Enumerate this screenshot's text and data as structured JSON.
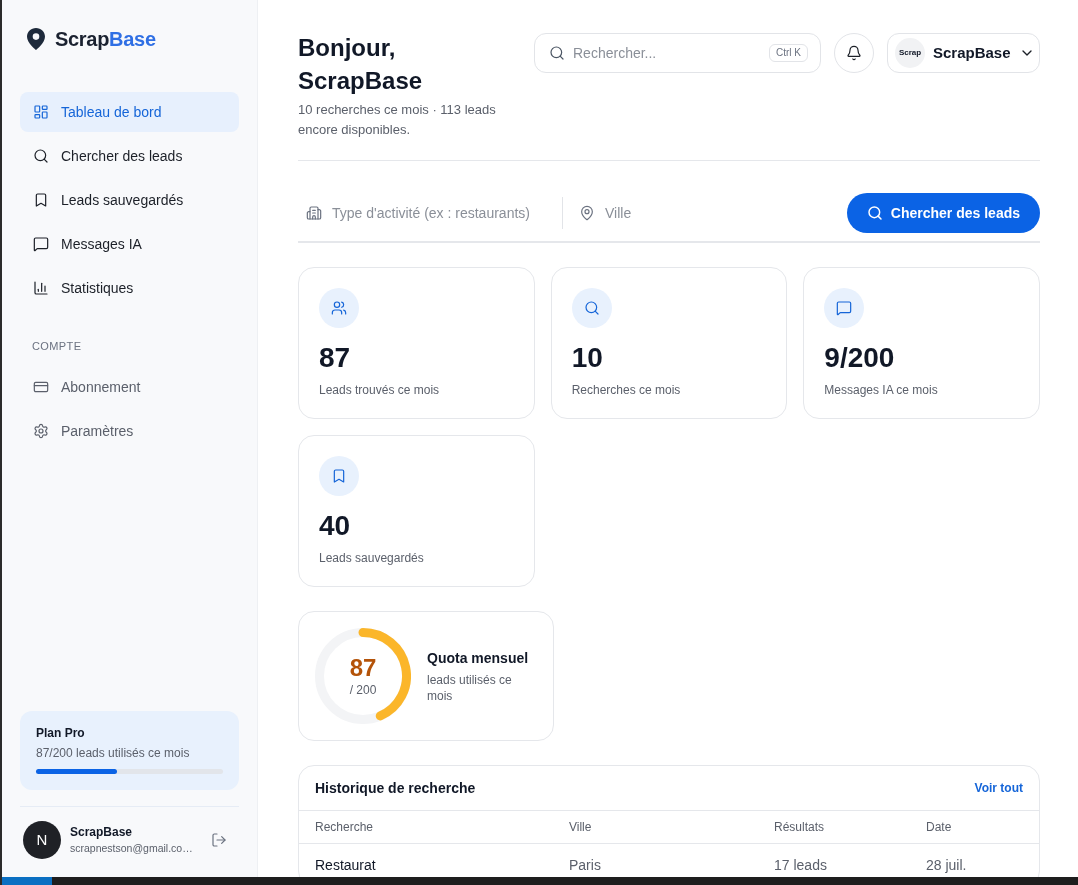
{
  "sidebar": {
    "brand": {
      "name_main": "Scrap",
      "name_accent": "Base"
    },
    "nav": [
      {
        "label": "Tableau de bord",
        "selected": true
      },
      {
        "label": "Chercher des leads",
        "selected": false
      },
      {
        "label": "Leads sauvegardés",
        "selected": false
      },
      {
        "label": "Messages IA",
        "selected": false
      },
      {
        "label": "Statistiques",
        "selected": false
      }
    ],
    "account_section": {
      "heading": "COMPTE",
      "items": [
        {
          "label": "Abonnement",
          "selected": false
        },
        {
          "label": "Paramètres",
          "selected": false
        }
      ]
    },
    "plan": {
      "title": "Plan Pro",
      "usage": "87/200 leads utilisés ce mois",
      "level": 0.435
    },
    "user": {
      "avatar": "N",
      "name": "ScrapBase",
      "email": "scrapnestson@gmail.co…"
    }
  },
  "header": {
    "greeting": "Bonjour, ScrapBase",
    "subtitle": "10 recherches ce mois · 113 leads encore disponibles.",
    "search": {
      "placeholder": "Rechercher...",
      "shortcut": "Ctrl K"
    },
    "account": {
      "avatar": "Scrap",
      "name": "ScrapBase"
    }
  },
  "lead_search": {
    "activity": {
      "placeholder": "Type d'activité (ex : restaurants)"
    },
    "city": {
      "placeholder": "Ville"
    },
    "button": "Chercher des leads"
  },
  "stats": [
    {
      "value": "87",
      "label": "Leads trouvés ce mois"
    },
    {
      "value": "10",
      "label": "Recherches ce mois"
    },
    {
      "value": "9/200",
      "label": "Messages IA ce mois"
    },
    {
      "value": "40",
      "label": "Leads sauvegardés"
    }
  ],
  "quota": {
    "value": "87",
    "total": "/ 200",
    "title": "Quota mensuel",
    "subtitle": "leads utilisés ce mois",
    "level": 0.435
  },
  "history": {
    "title": "Historique de recherche",
    "link": "Voir tout",
    "columns": [
      "Recherche",
      "Ville",
      "Résultats",
      "Date"
    ],
    "rows": [
      [
        "Restaurat",
        "Paris",
        "17 leads",
        "28 juil."
      ]
    ]
  }
}
